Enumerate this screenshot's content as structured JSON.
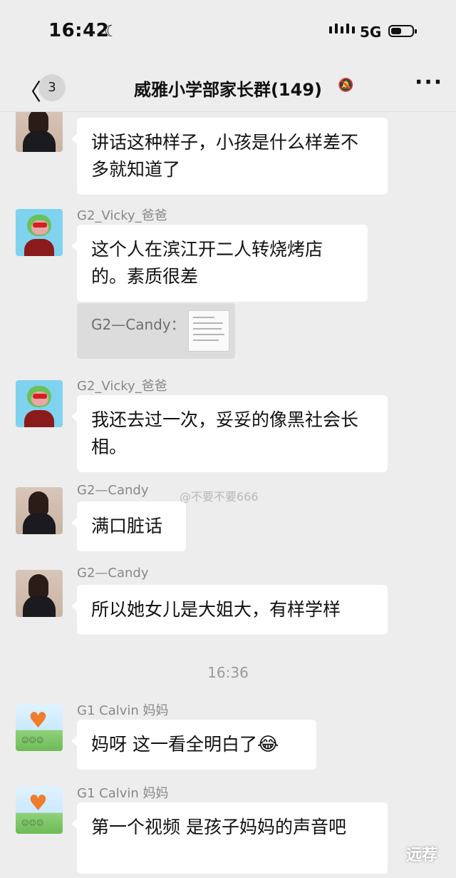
{
  "status_bar": {
    "time": "16:42",
    "moon": "☾",
    "network": "5G",
    "icons": [
      "moon-icon",
      "signal-icon",
      "battery-icon"
    ]
  },
  "header": {
    "back_glyph": "〈",
    "unread_count": "3",
    "title": "威雅小学部家长群(149)",
    "mute_glyph": "🔕",
    "more_glyph": "···",
    "icons": [
      "back-arrow-icon",
      "mute-bell-icon",
      "more-icon"
    ]
  },
  "messages": [
    {
      "sender": "",
      "text": "讲话这种样子，小孩是什么样差不多就知道了"
    },
    {
      "sender": "G2_Vicky_爸爸",
      "text": "这个人在滨江开二人转烧烤店的。素质很差"
    },
    {
      "quote_sender": "G2—Candy："
    },
    {
      "sender": "G2_Vicky_爸爸",
      "text": "我还去过一次，妥妥的像黑社会长相。"
    },
    {
      "sender": "G2—Candy",
      "text": "满口脏话"
    },
    {
      "sender": "G2—Candy",
      "text": "所以她女儿是大姐大，有样学样"
    },
    {
      "sender": "G1 Calvin 妈妈",
      "text": "妈呀 这一看全明白了",
      "emoji": "😂"
    },
    {
      "sender": "G1 Calvin 妈妈",
      "text": "第一个视频 是孩子妈妈的声音吧"
    }
  ],
  "time_separator": "16:36",
  "watermark": "@不要不要666",
  "corner_mark": "远荐",
  "colors": {
    "background": "#ededed",
    "bubble": "#ffffff",
    "name": "#888888"
  }
}
